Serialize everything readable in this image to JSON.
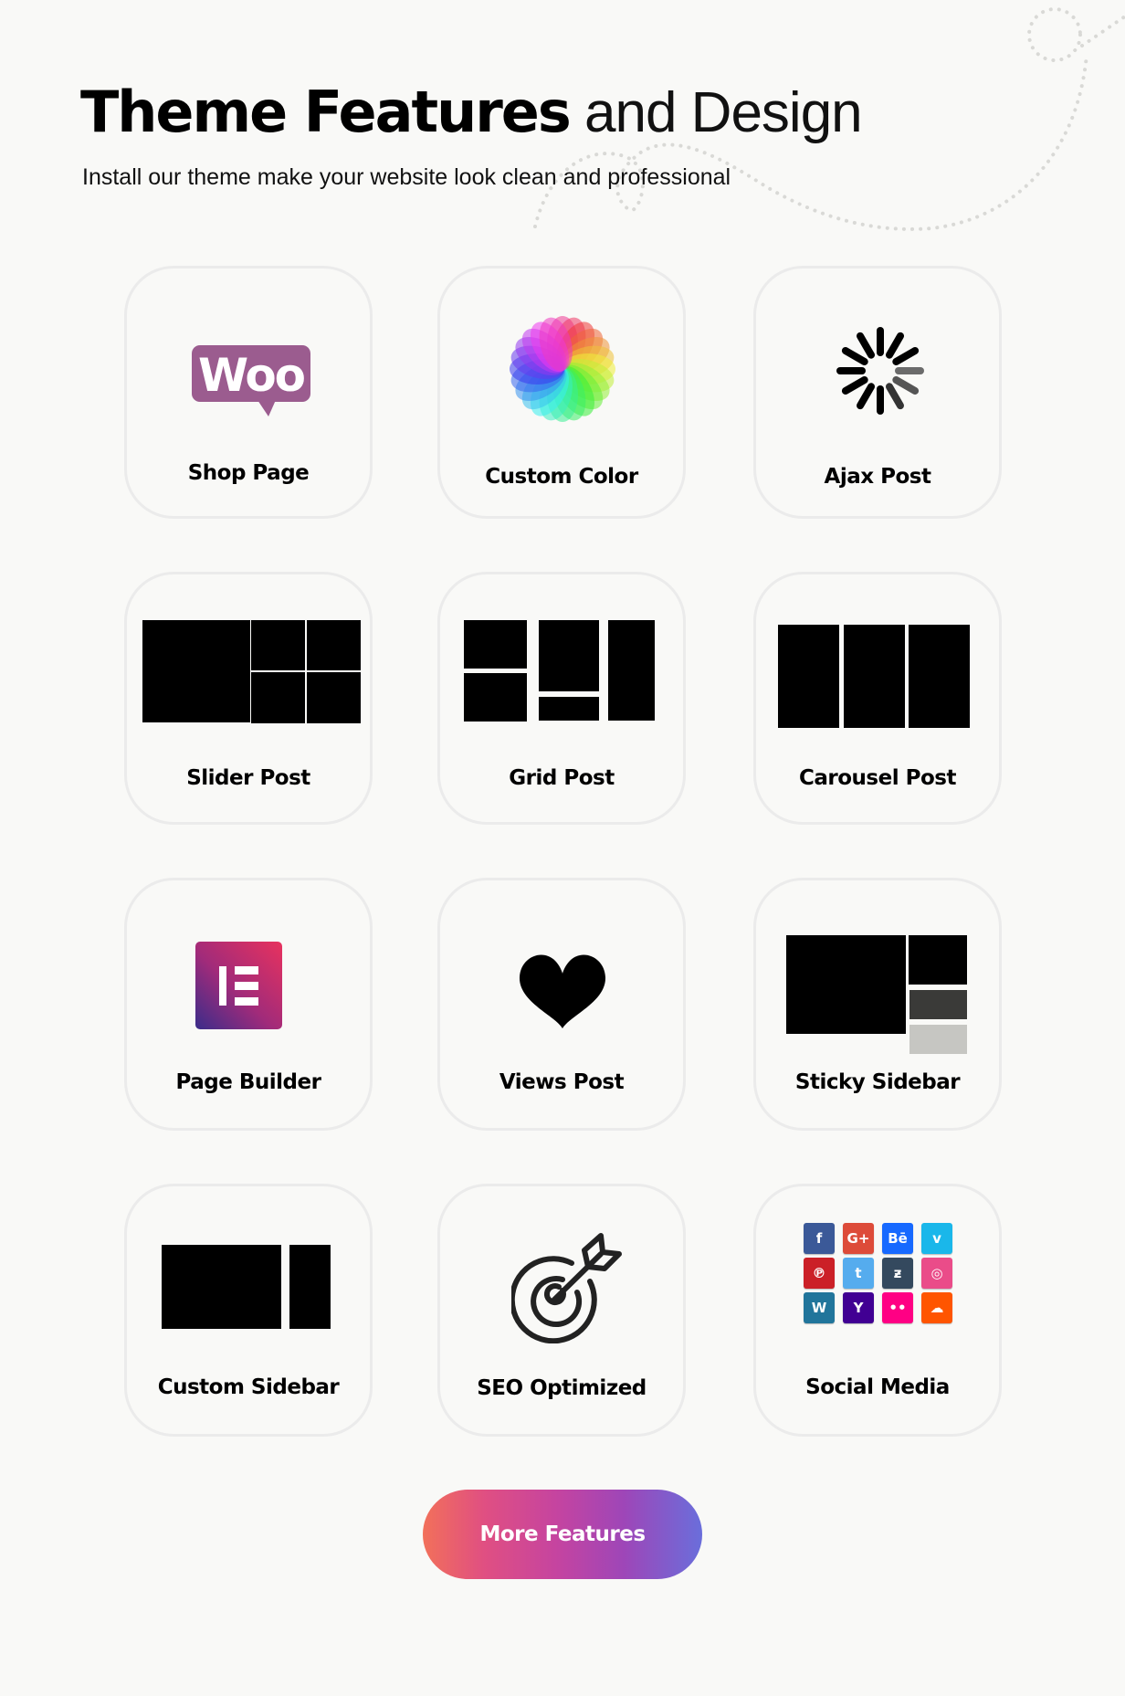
{
  "header": {
    "title_bold": "Theme Features",
    "title_light": "and Design",
    "subtitle": "Install our theme make your website look clean and professional"
  },
  "features": [
    {
      "label": "Shop Page",
      "icon": "woocommerce-logo-icon"
    },
    {
      "label": "Custom Color",
      "icon": "color-wheel-icon"
    },
    {
      "label": "Ajax Post",
      "icon": "loading-spinner-icon"
    },
    {
      "label": "Slider Post",
      "icon": "slider-layout-icon"
    },
    {
      "label": "Grid Post",
      "icon": "grid-layout-icon"
    },
    {
      "label": "Carousel Post",
      "icon": "carousel-layout-icon"
    },
    {
      "label": "Page Builder",
      "icon": "elementor-logo-icon"
    },
    {
      "label": "Views Post",
      "icon": "heart-icon"
    },
    {
      "label": "Sticky Sidebar",
      "icon": "sticky-sidebar-layout-icon"
    },
    {
      "label": "Custom Sidebar",
      "icon": "sidebar-layout-icon"
    },
    {
      "label": "SEO Optimized",
      "icon": "target-arrow-icon"
    },
    {
      "label": "Social Media",
      "icon": "social-icons-grid-icon"
    }
  ],
  "woo_text": "Woo",
  "social_icons": [
    {
      "name": "facebook",
      "glyph": "f",
      "color": "#3b5998"
    },
    {
      "name": "google-plus",
      "glyph": "G+",
      "color": "#dd4b39"
    },
    {
      "name": "behance",
      "glyph": "Bē",
      "color": "#1769ff"
    },
    {
      "name": "vimeo",
      "glyph": "v",
      "color": "#1ab7ea"
    },
    {
      "name": "pinterest",
      "glyph": "℗",
      "color": "#cb2027"
    },
    {
      "name": "twitter",
      "glyph": "t",
      "color": "#55acee"
    },
    {
      "name": "deviantart",
      "glyph": "ƶ",
      "color": "#34495e"
    },
    {
      "name": "dribbble",
      "glyph": "◎",
      "color": "#ea4c89"
    },
    {
      "name": "wordpress",
      "glyph": "W",
      "color": "#21759b"
    },
    {
      "name": "yahoo",
      "glyph": "Y",
      "color": "#410093"
    },
    {
      "name": "flickr",
      "glyph": "••",
      "color": "#ff0084"
    },
    {
      "name": "soundcloud",
      "glyph": "☁",
      "color": "#ff5500"
    }
  ],
  "colors": {
    "woo_purple": "#9b5c8f",
    "button_gradient": [
      "#f2705a",
      "#c544a0",
      "#6a6edb"
    ]
  },
  "cta": {
    "label": "More Features"
  }
}
